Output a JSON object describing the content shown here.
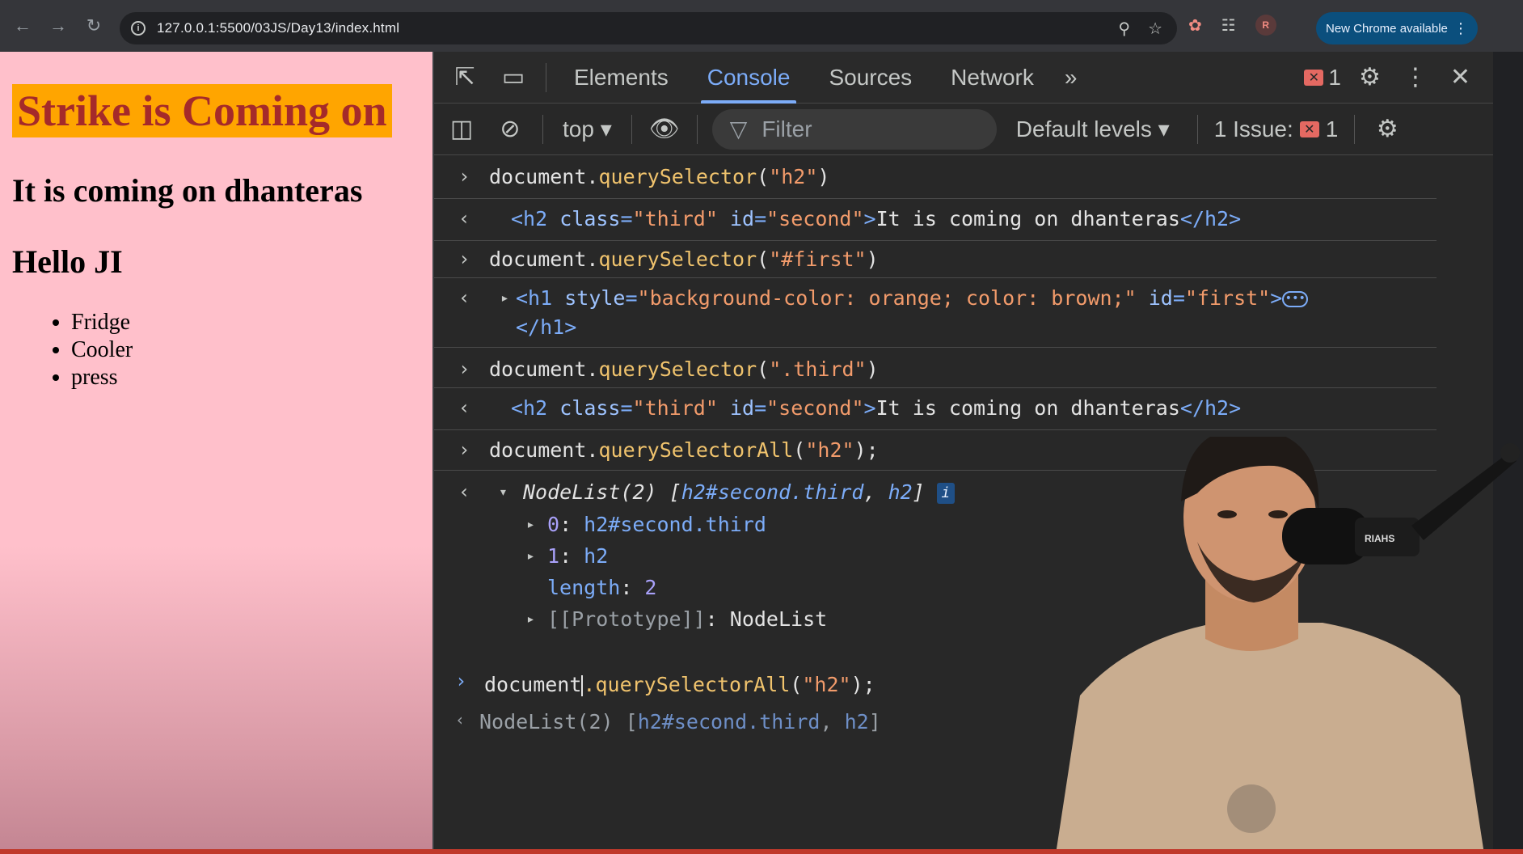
{
  "browser": {
    "url": "127.0.0.1:5500/03JS/Day13/index.html",
    "update_label": "New Chrome available",
    "profile_initial": "R"
  },
  "page": {
    "h1": "Strike is Coming on",
    "h2_second": "It is coming on dhanteras",
    "h2_hello": "Hello JI",
    "list_items": [
      "Fridge",
      "Cooler",
      "press"
    ],
    "bg_color": "#ffc0cb",
    "h1_bg": "#ffa500",
    "h1_color": "#a52a2a"
  },
  "devtools": {
    "tabs": [
      "Elements",
      "Console",
      "Sources",
      "Network"
    ],
    "active_tab": "Console",
    "error_count": "1",
    "context": "top",
    "filter_placeholder": "Filter",
    "levels": "Default levels",
    "issues_label": "1 Issue:",
    "issues_count": "1"
  },
  "console": {
    "cmd1": {
      "obj": "document.",
      "fn": "querySelector",
      "open": "(",
      "arg": "\"h2\"",
      "close": ")"
    },
    "res1": {
      "open": "<h2 ",
      "a1": "class",
      "eq1": "=",
      "v1": "\"third\"",
      "a2": " id",
      "eq2": "=",
      "v2": "\"second\"",
      "gt": ">",
      "text": "It is coming on dhanteras",
      "end": "</h2>"
    },
    "cmd2": {
      "obj": "document.",
      "fn": "querySelector",
      "open": "(",
      "arg": "\"#first\"",
      "close": ")"
    },
    "res2": {
      "open": "<h1 ",
      "a1": "style",
      "eq1": "=",
      "v1": "\"background-color: orange; color: brown;\"",
      "a2": " id",
      "eq2": "=",
      "v2": "\"first\"",
      "gt": ">",
      "end": "</h1>",
      "ellipsis": "•••"
    },
    "cmd3": {
      "obj": "document.",
      "fn": "querySelector",
      "open": "(",
      "arg": "\".third\"",
      "close": ")"
    },
    "res3": {
      "open": "<h2 ",
      "a1": "class",
      "eq1": "=",
      "v1": "\"third\"",
      "a2": " id",
      "eq2": "=",
      "v2": "\"second\"",
      "gt": ">",
      "text": "It is coming on dhanteras",
      "end": "</h2>"
    },
    "cmd4": {
      "obj": "document.",
      "fn": "querySelectorAll",
      "open": "(",
      "arg": "\"h2\"",
      "close": ");"
    },
    "res4": {
      "head": "NodeList(2) ",
      "lb": "[",
      "item1": "h2#second.third",
      "comma": ", ",
      "item2": "h2",
      "rb": "]",
      "info": "i",
      "row0_key": "0",
      "row0_val": "h2#second.third",
      "row1_key": "1",
      "row1_val": "h2",
      "len_key": "length",
      "len_val": "2",
      "proto_key": "[[Prototype]]",
      "proto_val": "NodeList"
    },
    "input": {
      "obj": "document",
      "fn": ".querySelectorAll",
      "open": "(",
      "arg": "\"h2\"",
      "close": ");"
    },
    "preview": {
      "head": "NodeList(2) ",
      "lb": "[",
      "item1": "h2#second.third",
      "comma": ", ",
      "item2": "h2",
      "rb": "]"
    }
  }
}
